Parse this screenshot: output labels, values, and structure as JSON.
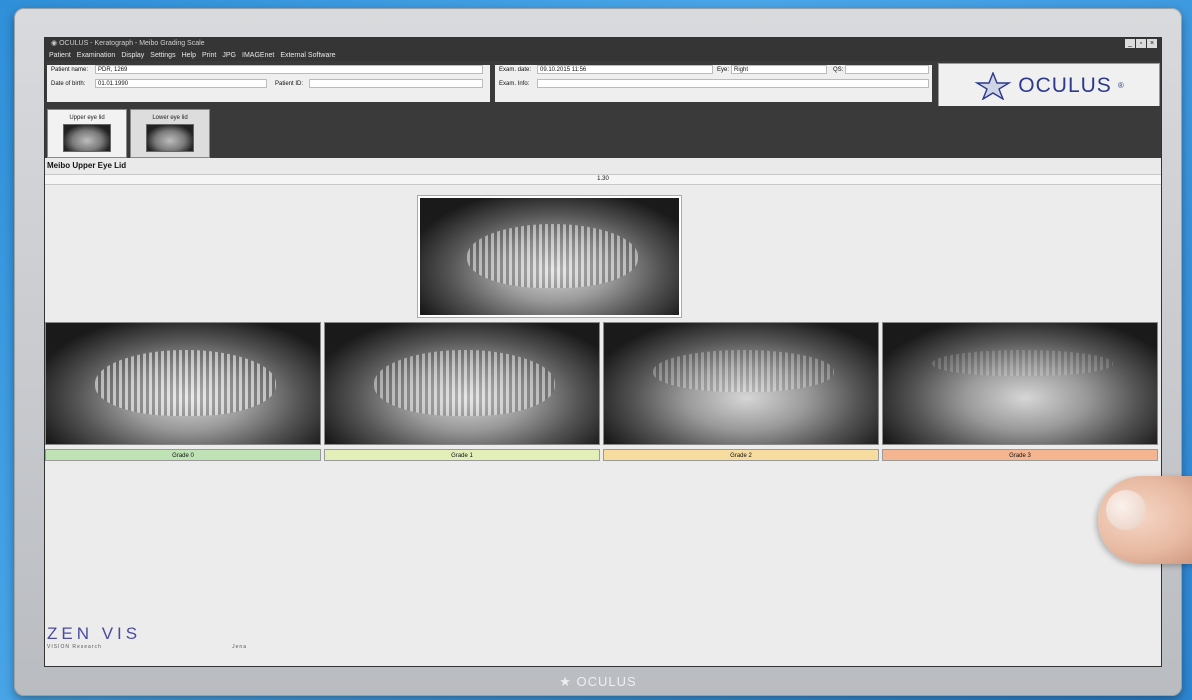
{
  "window": {
    "title": "OCULUS - Keratograph - Meibo Grading Scale",
    "controls": [
      "_",
      "▫",
      "×"
    ]
  },
  "menu": [
    "Patient",
    "Examination",
    "Display",
    "Settings",
    "Help",
    "Print",
    "JPG",
    "IMAGEnet",
    "External Software"
  ],
  "patient": {
    "name_label": "Patient name:",
    "name_value": "PDR, 1269",
    "dob_label": "Date of birth:",
    "dob_value": "01.01.1990",
    "id_label": "Patient ID:",
    "id_value": ""
  },
  "exam": {
    "date_label": "Exam. date:",
    "date_value": "09.10.2015 11:56",
    "eye_label": "Eye:",
    "eye_value": "Right",
    "qs_label": "QS:",
    "qs_value": "",
    "info_label": "Exam. Info:",
    "info_value": ""
  },
  "logo": {
    "text": "OCULUS",
    "mark": "®"
  },
  "thumbs": [
    {
      "label": "Upper eye lid",
      "active": true
    },
    {
      "label": "Lower eye lid",
      "active": false
    }
  ],
  "section_title": "Meibo Upper Eye Lid",
  "value_display": "1.30",
  "grades": [
    {
      "label": "Grade 0",
      "color": "#bfe3b5"
    },
    {
      "label": "Grade 1",
      "color": "#e2efb9"
    },
    {
      "label": "Grade 2",
      "color": "#f6dc9f"
    },
    {
      "label": "Grade 3",
      "color": "#f4b590"
    }
  ],
  "brand": {
    "text": "ZEN VIS",
    "sub_left": "VISION Research",
    "sub_right": "Jena"
  },
  "bezel_logo": "OCULUS"
}
